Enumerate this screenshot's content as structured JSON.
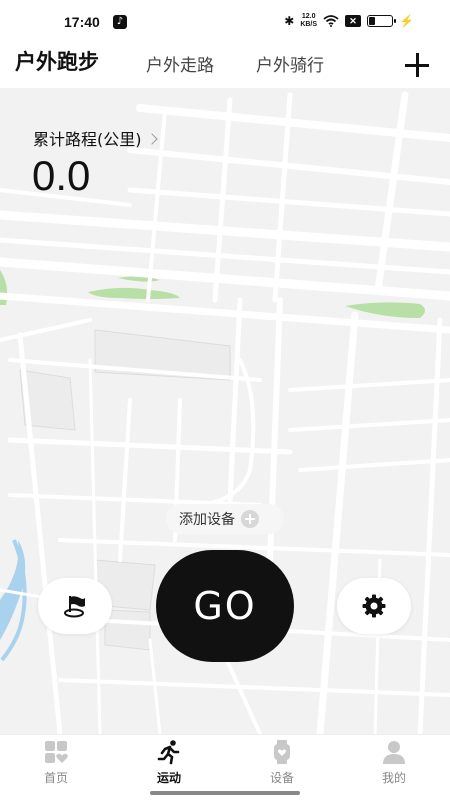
{
  "status_bar": {
    "time": "17:40",
    "net_speed_value": "12.0",
    "net_speed_unit": "KB/S",
    "battery_percent": 30
  },
  "tabs": [
    {
      "label": "户外跑步",
      "active": true
    },
    {
      "label": "户外走路",
      "active": false
    },
    {
      "label": "户外骑行",
      "active": false
    }
  ],
  "summary": {
    "distance_label": "累计路程(公里)",
    "distance_value": "0.0"
  },
  "map": {
    "add_device_label": "添加设备",
    "go_label": "GO"
  },
  "bottom_nav": [
    {
      "label": "首页",
      "icon": "home-icon",
      "active": false
    },
    {
      "label": "运动",
      "icon": "runner-icon",
      "active": true
    },
    {
      "label": "设备",
      "icon": "watch-icon",
      "active": false
    },
    {
      "label": "我的",
      "icon": "person-icon",
      "active": false
    }
  ],
  "colors": {
    "map_bg": "#f2f2f2",
    "road": "#ffffff",
    "park": "#b7dfa6",
    "water": "#a9d2ee",
    "accent": "#111111"
  }
}
